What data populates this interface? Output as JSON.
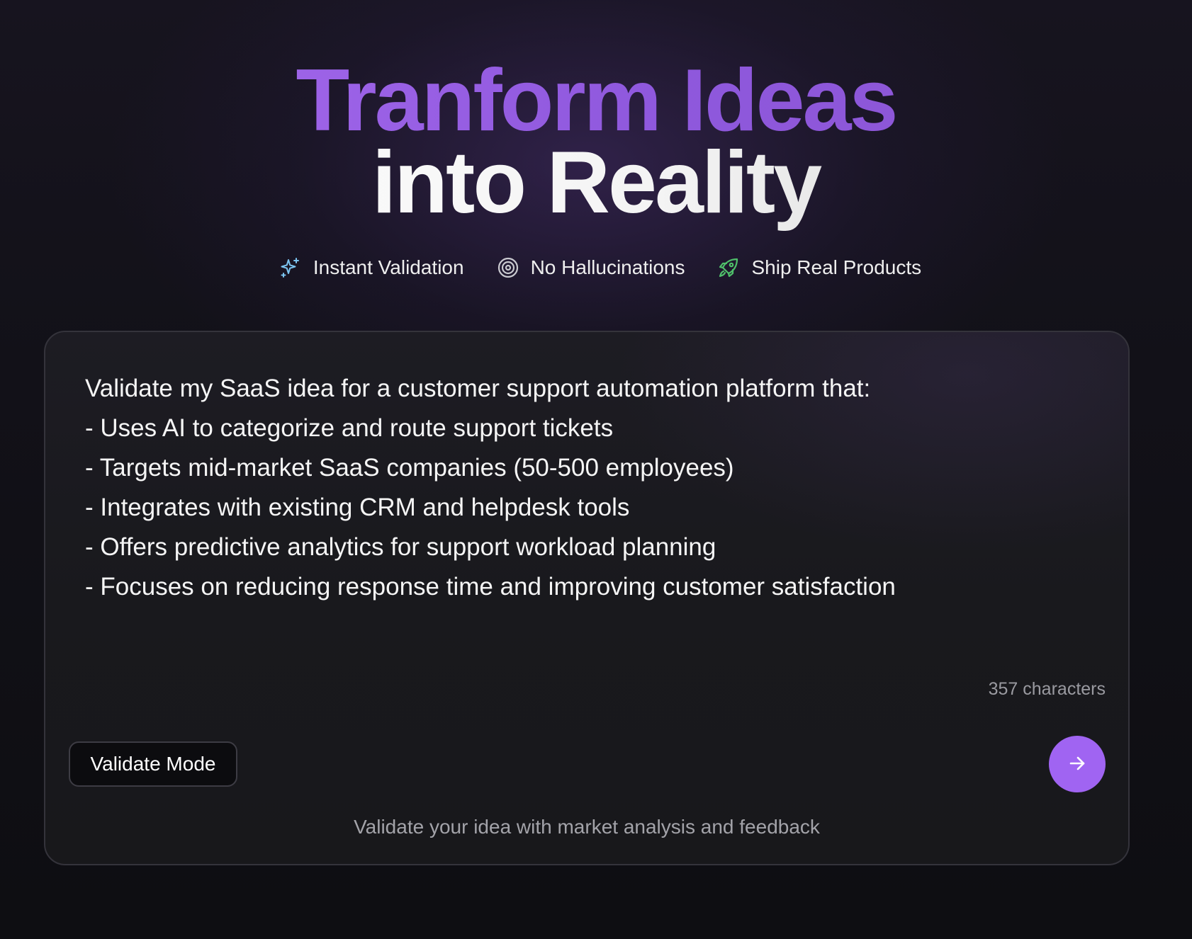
{
  "hero": {
    "title_line1": "Tranform Ideas",
    "title_line2": "into Reality"
  },
  "features": [
    {
      "label": "Instant Validation",
      "icon": "sparkles-icon",
      "icon_color": "#7cc4f0"
    },
    {
      "label": "No Hallucinations",
      "icon": "target-icon",
      "icon_color": "#c9c9cf"
    },
    {
      "label": "Ship Real Products",
      "icon": "rocket-icon",
      "icon_color": "#4fbf6a"
    }
  ],
  "prompt": {
    "lines": [
      "Validate my SaaS idea for a customer support automation platform that:",
      "- Uses AI to categorize and route support tickets",
      "- Targets mid-market SaaS companies (50-500 employees)",
      "- Integrates with existing CRM and helpdesk tools",
      "- Offers predictive analytics for support workload planning",
      "- Focuses on reducing response time and improving customer satisfaction"
    ],
    "char_count": "357 characters"
  },
  "controls": {
    "mode_label": "Validate Mode",
    "submit_icon": "arrow-right-icon",
    "mode_description": "Validate your idea with market analysis and feedback"
  },
  "colors": {
    "accent": "#a064f2",
    "title_gradient_start": "#a86cf0",
    "background": "#121118"
  }
}
